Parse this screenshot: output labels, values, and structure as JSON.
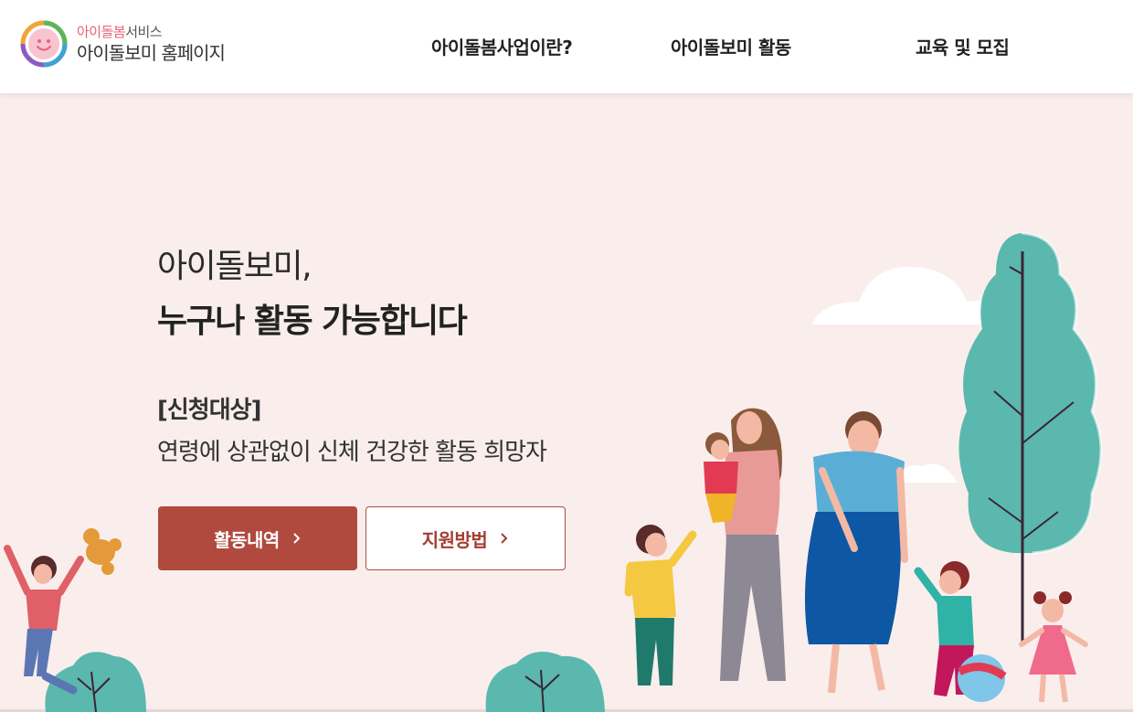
{
  "header": {
    "logo": {
      "service_accent": "아이돌봄",
      "service_rest": "서비스",
      "homepage": "아이돌보미 홈페이지"
    },
    "nav": [
      {
        "label": "아이돌봄사업이란?"
      },
      {
        "label": "아이돌보미 활동"
      },
      {
        "label": "교육 및 모집"
      }
    ]
  },
  "hero": {
    "line1": "아이돌보미,",
    "line2": "누구나 활동 가능합니다",
    "target_label": "[신청대상]",
    "target_desc": "연령에 상관없이 신체 건강한 활동 희망자",
    "buttons": {
      "primary": "활동내역",
      "secondary": "지원방법"
    }
  },
  "colors": {
    "background": "#f9eeec",
    "accent_brown": "#b04a3e",
    "logo_pink": "#e8627a",
    "tree_teal": "#5bb8ae"
  },
  "icons": [
    "smile-logo-icon",
    "chevron-right-icon"
  ]
}
